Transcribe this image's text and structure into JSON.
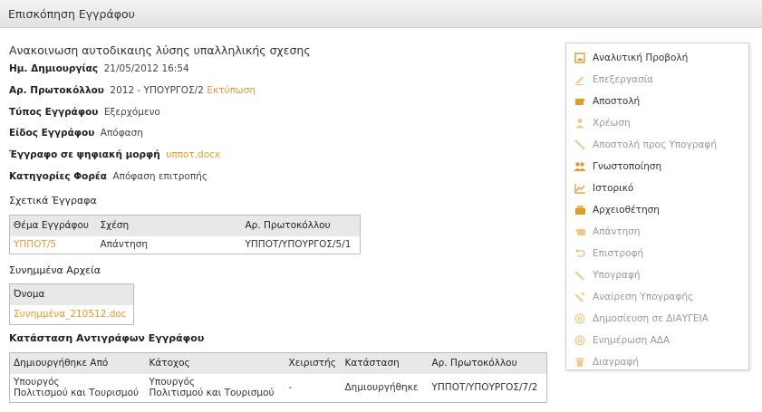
{
  "header": {
    "title": "Επισκόπηση Εγγράφου"
  },
  "document": {
    "title": "Ανακοινωση αυτοδικαιης λύσης υπαλληλικής σχεσης",
    "fields": [
      {
        "label": "Ημ. Δημιουργίας",
        "value": "21/05/2012 16:54"
      },
      {
        "label": "Αρ. Πρωτοκόλλου",
        "value": "2012 - ΥΠΟΥΡΓΟΣ/2",
        "link": "Εκτύπωση"
      },
      {
        "label": "Τύπος Εγγράφου",
        "value": "Εξερχόμενο"
      },
      {
        "label": "Είδος Εγγράφου",
        "value": "Απόφαση"
      },
      {
        "label": "Έγγραφο σε ψηφιακή μορφή",
        "link": "υππoτ.docx"
      },
      {
        "label": "Κατηγορίες Φορέα",
        "value": "Απόφαση επιτροπής"
      }
    ]
  },
  "related": {
    "heading": "Σχετικά Έγγραφα",
    "columns": [
      "Θέμα Εγγράφου",
      "Σχέση",
      "Αρ. Πρωτοκόλλου"
    ],
    "rows": [
      {
        "subject": "ΥΠΠΟΤ/5",
        "relation": "Απάντηση",
        "protocol": "ΥΠΠΟΤ/ΥΠΟΥΡΓΟΣ/5/1"
      }
    ]
  },
  "attachments": {
    "heading": "Συνημμένα Αρχεία",
    "columns": [
      "Όνομα"
    ],
    "rows": [
      {
        "name": "Συνημμένα_210512.doc"
      }
    ]
  },
  "copies": {
    "heading": "Κατάσταση Αντιγράφων Εγγράφου",
    "columns": [
      "Δημιουργήθηκε Από",
      "Κάτοχος",
      "Χειριστής",
      "Κατάσταση",
      "Αρ. Πρωτοκόλλου"
    ],
    "rows": [
      {
        "created_by_1": "Υπουργός",
        "created_by_2": "Πολιτισμού και Τουρισμού",
        "holder_1": "Υπουργός",
        "holder_2": "Πολιτισμού και Τουρισμού",
        "operator": "-",
        "status": "Δημιουργήθηκε",
        "protocol": "ΥΠΠΟΤ/ΥΠΟΥΡΓΟΣ/7/2"
      }
    ]
  },
  "actions": [
    {
      "label": "Αναλυτική Προβολή",
      "icon": "detail-view-icon",
      "enabled": true
    },
    {
      "label": "Επεξεργασία",
      "icon": "edit-icon",
      "enabled": false
    },
    {
      "label": "Αποστολή",
      "icon": "send-icon",
      "enabled": true
    },
    {
      "label": "Χρέωση",
      "icon": "user-icon",
      "enabled": false
    },
    {
      "label": "Αποστολή προς Υπογραφή",
      "icon": "pen-icon",
      "enabled": false
    },
    {
      "label": "Γνωστοποίηση",
      "icon": "users-icon",
      "enabled": true
    },
    {
      "label": "Ιστορικό",
      "icon": "history-chart-icon",
      "enabled": true
    },
    {
      "label": "Αρχειοθέτηση",
      "icon": "archive-icon",
      "enabled": true
    },
    {
      "label": "Απάντηση",
      "icon": "reply-icon",
      "enabled": false
    },
    {
      "label": "Επιστροφή",
      "icon": "return-icon",
      "enabled": false
    },
    {
      "label": "Υπογραφή",
      "icon": "sign-icon",
      "enabled": false
    },
    {
      "label": "Αναίρεση Υπογραφής",
      "icon": "unsign-icon",
      "enabled": false
    },
    {
      "label": "Δημοσίευση σε ΔΙΑΥΓΕΙΑ",
      "icon": "at-icon",
      "enabled": false
    },
    {
      "label": "Ενημέρωση ΑΔΑ",
      "icon": "at-icon",
      "enabled": false
    },
    {
      "label": "Διαγραφή",
      "icon": "trash-icon",
      "enabled": false
    }
  ],
  "colors": {
    "accent": "#e29a2b",
    "disabled_text": "#999999",
    "header_bg": "#e8e8e8"
  }
}
